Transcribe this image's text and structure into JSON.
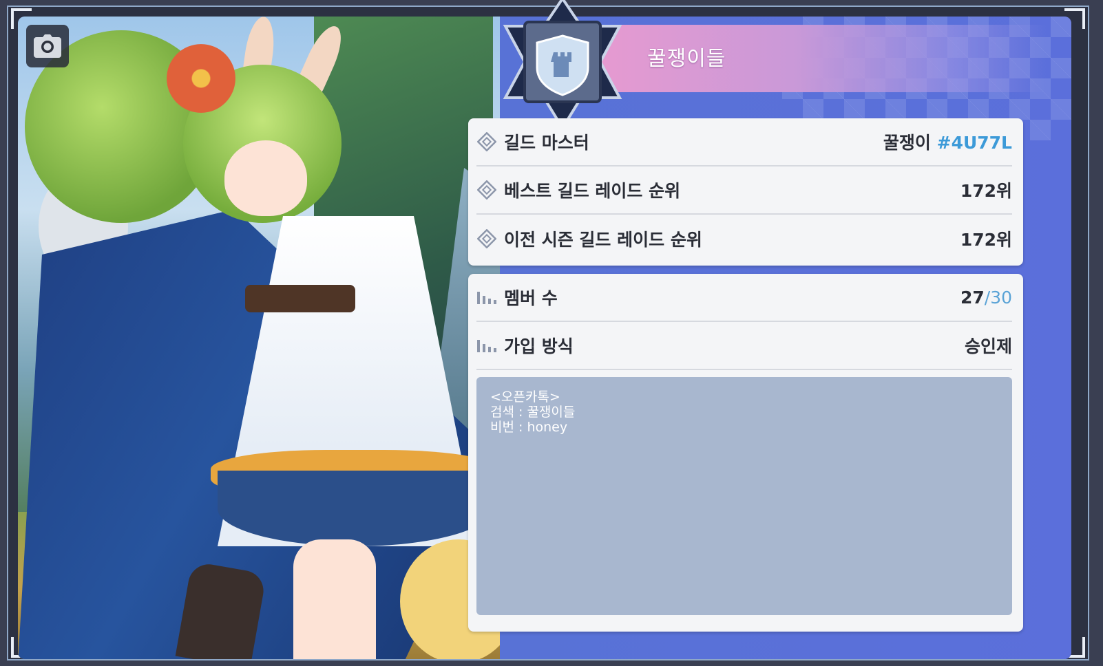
{
  "guild": {
    "name": "꿀쟁이들"
  },
  "info_rows": [
    {
      "label": "길드 마스터",
      "value": "꿀쟁이",
      "tag": "#4U77L"
    },
    {
      "label": "베스트 길드 레이드 순위",
      "value": "172위"
    },
    {
      "label": "이전 시즌 길드 레이드 순위",
      "value": "172위"
    }
  ],
  "stats_rows": [
    {
      "label": "멤버 수",
      "current": "27",
      "max": "/30"
    },
    {
      "label": "가입 방식",
      "value": "승인제"
    }
  ],
  "notice": {
    "text": "<오픈카톡>\n검색 : 꿀쟁이들\n비번 : honey"
  },
  "icons": {
    "camera": "camera-icon",
    "emblem": "shield-tower-icon",
    "info_row": "diamond-bullet-icon",
    "stats_row": "bar-chart-icon"
  },
  "colors": {
    "accent_blue": "#3c9ad8",
    "panel_bg": "#5b6fdb",
    "banner_pink": "#e79ad0"
  }
}
